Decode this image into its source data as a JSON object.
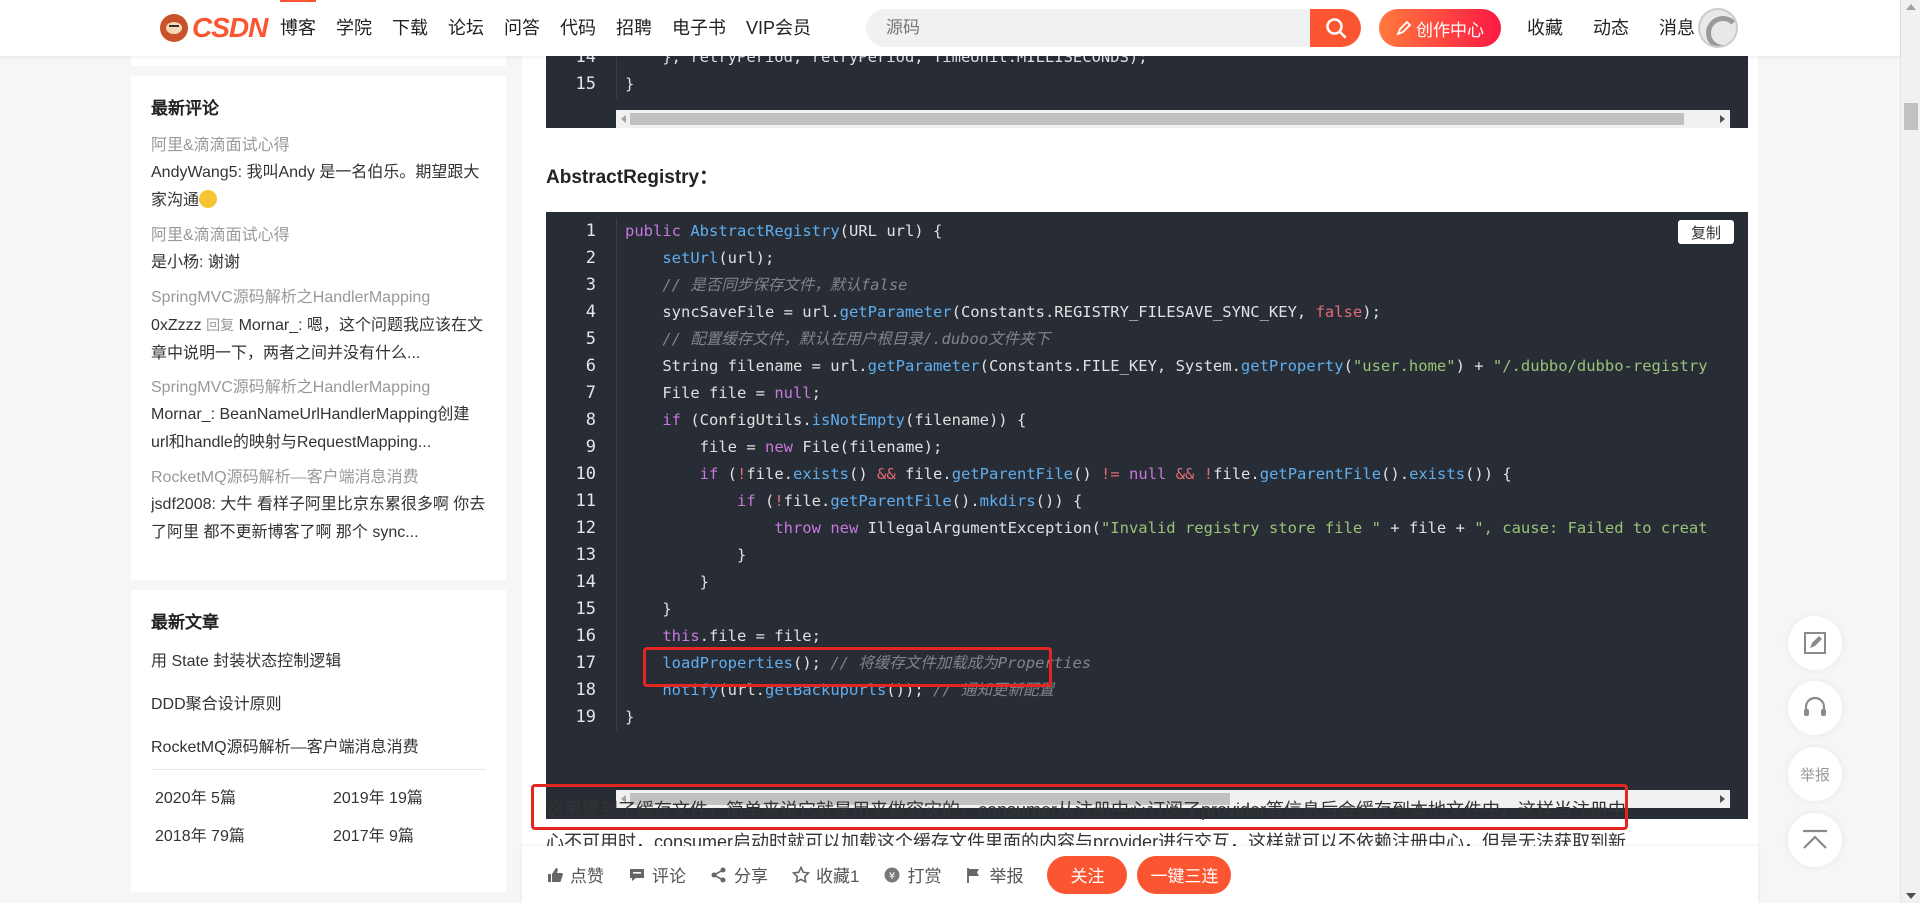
{
  "header": {
    "logo": "CSDN",
    "nav": [
      "博客",
      "学院",
      "下载",
      "论坛",
      "问答",
      "代码",
      "招聘",
      "电子书",
      "VIP会员"
    ],
    "search_placeholder": "源码",
    "create_label": "创作中心",
    "tools": [
      "收藏",
      "动态",
      "消息"
    ]
  },
  "sidebar": {
    "comments_title": "最新评论",
    "comments": [
      {
        "title": "阿里&滴滴面试心得",
        "body": "AndyWang5: 我叫Andy 是一名伯乐。期望跟大家沟通"
      },
      {
        "title": "阿里&滴滴面试心得",
        "body": "是小杨: 谢谢"
      },
      {
        "title": "SpringMVC源码解析之HandlerMapping",
        "user": "0xZzzz",
        "reply": "回复",
        "body": "Mornar_: 嗯，这个问题我应该在文章中说明一下，两者之间并没有什么..."
      },
      {
        "title": "SpringMVC源码解析之HandlerMapping",
        "body": "Mornar_: BeanNameUrlHandlerMapping创建url和handle的映射与RequestMapping..."
      },
      {
        "title": "RocketMQ源码解析—客户端消息消费",
        "body": "jsdf2008: 大牛 看样子阿里比京东累很多啊 你去了阿里 都不更新博客了啊 那个 sync..."
      }
    ],
    "articles_title": "最新文章",
    "articles": [
      "用 State 封装状态控制逻辑",
      "DDD聚合设计原则",
      "RocketMQ源码解析—客户端消息消费"
    ],
    "archive": [
      "2020年 5篇",
      "2019年 19篇",
      "2018年 79篇",
      "2017年 9篇"
    ]
  },
  "main": {
    "code1": [
      {
        "n": "14",
        "text": "    }, retryPeriod, retryPeriod, TimeUnit.MILLISECONDS);"
      },
      {
        "n": "15",
        "text": "}"
      }
    ],
    "heading": "AbstractRegistry：",
    "copy_label": "复制",
    "code2_numbers": [
      "1",
      "2",
      "3",
      "4",
      "5",
      "6",
      "7",
      "8",
      "9",
      "10",
      "11",
      "12",
      "13",
      "14",
      "15",
      "16",
      "17",
      "18",
      "19"
    ],
    "paragraph": "这里提到了缓存文件，简单来说它就是用来做容灾的，consumer从注册中心订阅了provider等信息后会缓存到本地文件中，这样当注册中",
    "paragraph2": "心不可用时，consumer启动时就可以加载这个缓存文件里面的内容与provider进行交互，这样就可以不依赖注册中心，但是无法获取到新"
  },
  "actionbar": {
    "items": [
      "点赞",
      "评论",
      "分享",
      "收藏1",
      "打赏",
      "举报"
    ],
    "follow": "关注",
    "triple": "一键三连"
  },
  "float_tools": {
    "report": "举报"
  }
}
